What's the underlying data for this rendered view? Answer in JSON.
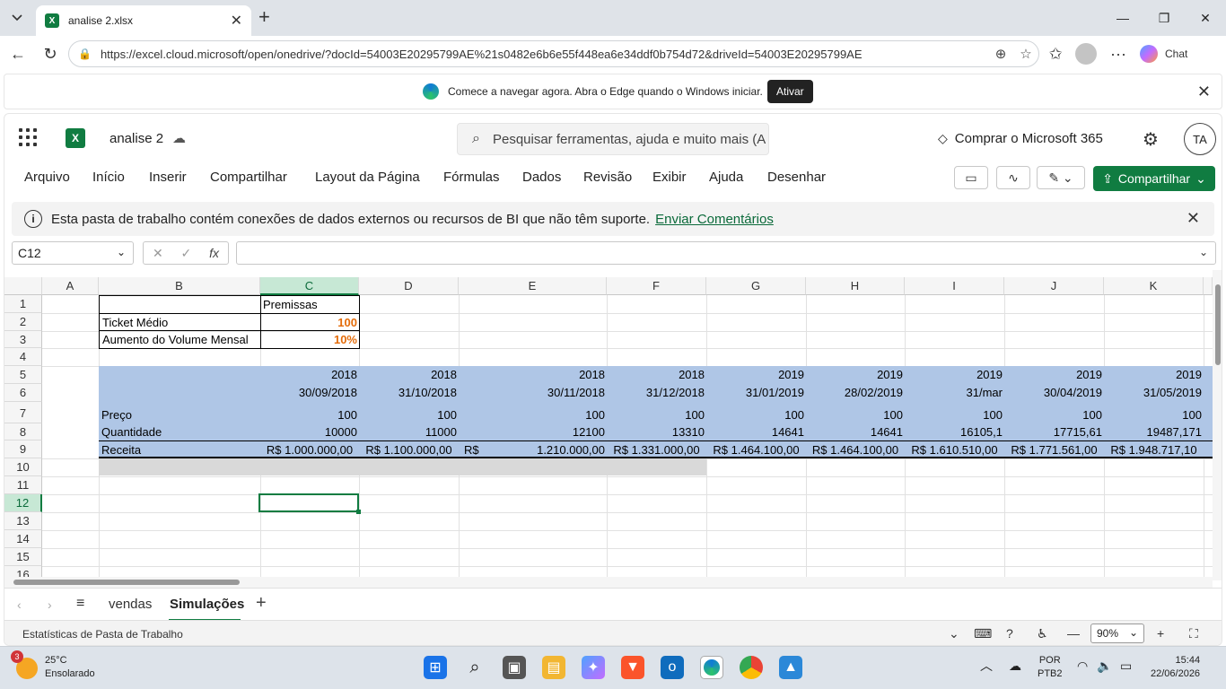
{
  "browser": {
    "tab_title": "analise 2.xlsx",
    "url": "https://excel.cloud.microsoft/open/onedrive/?docId=54003E20295799AE%21s0482e6b6e55f448ea6e34ddf0b754d72&driveId=54003E20295799AE",
    "chat_label": "Chat"
  },
  "edge_notice": {
    "message": "Comece a navegar agora. Abra o Edge quando o Windows iniciar.",
    "button": "Ativar"
  },
  "excel": {
    "doc_name": "analise 2",
    "search_placeholder": "Pesquisar ferramentas, ajuda e muito mais (A",
    "buy_label": "Comprar o Microsoft 365",
    "user_initials": "TA",
    "ribbon_tabs": [
      "Arquivo",
      "Início",
      "Inserir",
      "Compartilhar",
      "Layout da Página",
      "Fórmulas",
      "Dados",
      "Revisão",
      "Exibir",
      "Ajuda",
      "Desenhar"
    ],
    "share_label": "Compartilhar",
    "info_message": "Esta pasta de trabalho contém conexões de dados externos ou recursos de BI que não têm suporte.",
    "info_link": "Enviar Comentários",
    "name_box": "C12",
    "columns": [
      "A",
      "B",
      "C",
      "D",
      "E",
      "F",
      "G",
      "H",
      "I",
      "J",
      "K"
    ],
    "rows": [
      "1",
      "2",
      "3",
      "4",
      "5",
      "6",
      "7",
      "8",
      "9",
      "10",
      "11",
      "12",
      "13",
      "14",
      "15",
      "16"
    ],
    "cells": {
      "c1": "Premissas",
      "b2": "Ticket Médio",
      "c2": "100",
      "b3": "Aumento do Volume Mensal",
      "c3": "10%",
      "year_row": [
        "2018",
        "2018",
        "2018",
        "2018",
        "2019",
        "2019",
        "2019",
        "2019",
        "2019"
      ],
      "date_row": [
        "30/09/2018",
        "31/10/2018",
        "30/11/2018",
        "31/12/2018",
        "31/01/2019",
        "28/02/2019",
        "31/mar",
        "30/04/2019",
        "31/05/2019"
      ],
      "b7": "Preço",
      "price_row": [
        "100",
        "100",
        "100",
        "100",
        "100",
        "100",
        "100",
        "100",
        "100"
      ],
      "b8": "Quantidade",
      "qty_row": [
        "10000",
        "11000",
        "12100",
        "13310",
        "14641",
        "14641",
        "16105,1",
        "17715,61",
        "19487,171"
      ],
      "b9": "Receita",
      "revenue_row": [
        "R$ 1.000.000,00",
        "R$ 1.100.000,00",
        "R$",
        "1.210.000,00",
        "R$ 1.331.000,00",
        "R$ 1.464.100,00",
        "R$ 1.464.100,00",
        "R$ 1.610.510,00",
        "R$ 1.771.561,00",
        "R$ 1.948.717,10"
      ]
    },
    "sheets": [
      "vendas",
      "Simulações"
    ],
    "active_sheet": "Simulações",
    "status_left": "Estatísticas de Pasta de Trabalho",
    "zoom": "90%"
  },
  "taskbar": {
    "weather_temp": "25°C",
    "weather_desc": "Ensolarado",
    "weather_badge": "3",
    "lang1": "POR",
    "lang2": "PTB2",
    "time": "15:44",
    "date": "22/06/2026"
  }
}
